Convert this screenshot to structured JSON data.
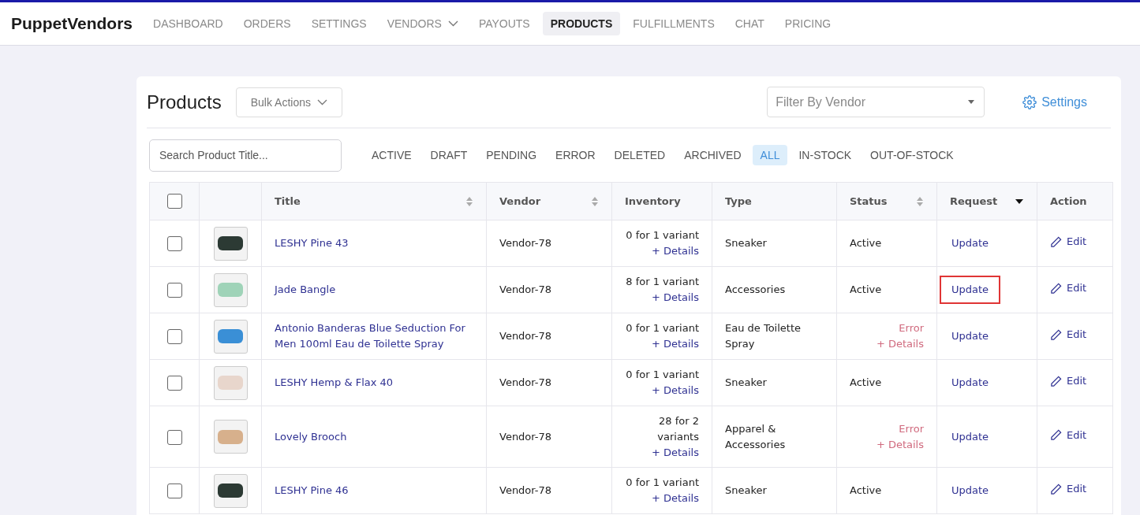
{
  "brand": "PuppetVendors",
  "nav": [
    {
      "label": "DASHBOARD",
      "selected": false,
      "dropdown": false
    },
    {
      "label": "ORDERS",
      "selected": false,
      "dropdown": false
    },
    {
      "label": "SETTINGS",
      "selected": false,
      "dropdown": false
    },
    {
      "label": "VENDORS",
      "selected": false,
      "dropdown": true
    },
    {
      "label": "PAYOUTS",
      "selected": false,
      "dropdown": false
    },
    {
      "label": "PRODUCTS",
      "selected": true,
      "dropdown": false
    },
    {
      "label": "FULFILLMENTS",
      "selected": false,
      "dropdown": false
    },
    {
      "label": "CHAT",
      "selected": false,
      "dropdown": false
    },
    {
      "label": "PRICING",
      "selected": false,
      "dropdown": false
    }
  ],
  "page_title": "Products",
  "bulk_actions": "Bulk Actions",
  "vendor_filter": {
    "placeholder": "Filter By Vendor"
  },
  "settings_link": "Settings",
  "search": {
    "placeholder": "Search Product Title..."
  },
  "filters": [
    {
      "label": "ACTIVE",
      "selected": false
    },
    {
      "label": "DRAFT",
      "selected": false
    },
    {
      "label": "PENDING",
      "selected": false
    },
    {
      "label": "ERROR",
      "selected": false
    },
    {
      "label": "DELETED",
      "selected": false
    },
    {
      "label": "ARCHIVED",
      "selected": false
    },
    {
      "label": "ALL",
      "selected": true
    },
    {
      "label": "IN-STOCK",
      "selected": false
    },
    {
      "label": "OUT-OF-STOCK",
      "selected": false
    }
  ],
  "table": {
    "select_all": false,
    "columns": [
      {
        "label": "Title",
        "kind": "sortable"
      },
      {
        "label": "Vendor",
        "kind": "sortable"
      },
      {
        "label": "Inventory",
        "kind": "plain"
      },
      {
        "label": "Type",
        "kind": "plain"
      },
      {
        "label": "Status",
        "kind": "sortable"
      },
      {
        "label": "Request",
        "kind": "menu"
      },
      {
        "label": "Action",
        "kind": "plain"
      }
    ],
    "rows": [
      {
        "checked": false,
        "title": "LESHY Pine 43",
        "vendor": "Vendor-78",
        "inventory": "0 for 1 variant",
        "inventory_link": "+ Details",
        "type": "Sneaker",
        "status": {
          "kind": "ok",
          "text": "Active"
        },
        "request": "Update",
        "highlighted": false,
        "action": "Edit"
      },
      {
        "checked": false,
        "title": "Jade Bangle",
        "vendor": "Vendor-78",
        "inventory": "8 for 1 variant",
        "inventory_link": "+ Details",
        "type": "Accessories",
        "status": {
          "kind": "ok",
          "text": "Active"
        },
        "request": "Update",
        "highlighted": true,
        "action": "Edit"
      },
      {
        "checked": false,
        "title": "Antonio Banderas Blue Seduction For Men 100ml Eau de Toilette Spray",
        "vendor": "Vendor-78",
        "inventory": "0 for 1 variant",
        "inventory_link": "+ Details",
        "type": "Eau de Toilette Spray",
        "status": {
          "kind": "error",
          "text": "Error",
          "link": "+ Details"
        },
        "request": "Update",
        "highlighted": false,
        "action": "Edit"
      },
      {
        "checked": false,
        "title": "LESHY Hemp & Flax 40",
        "vendor": "Vendor-78",
        "inventory": "0 for 1 variant",
        "inventory_link": "+ Details",
        "type": "Sneaker",
        "status": {
          "kind": "ok",
          "text": "Active"
        },
        "request": "Update",
        "highlighted": false,
        "action": "Edit"
      },
      {
        "checked": false,
        "title": "Lovely Brooch",
        "vendor": "Vendor-78",
        "inventory": "28 for 2 variants",
        "inventory_link": "+ Details",
        "type": "Apparel & Accessories",
        "status": {
          "kind": "error",
          "text": "Error",
          "link": "+ Details"
        },
        "request": "Update",
        "highlighted": false,
        "action": "Edit"
      },
      {
        "checked": false,
        "title": "LESHY Pine 46",
        "vendor": "Vendor-78",
        "inventory": "0 for 1 variant",
        "inventory_link": "+ Details",
        "type": "Sneaker",
        "status": {
          "kind": "ok",
          "text": "Active"
        },
        "request": "Update",
        "highlighted": false,
        "action": "Edit"
      }
    ]
  }
}
